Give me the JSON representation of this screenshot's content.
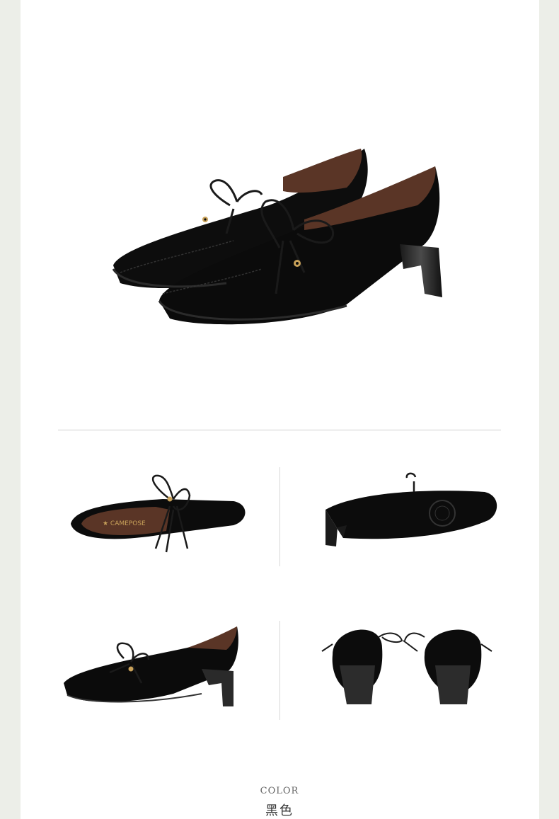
{
  "product": {
    "color_heading": "COLOR",
    "color_name": "黑色"
  },
  "colors": {
    "background": "#eceee8",
    "panel": "#ffffff",
    "suede": "#0b0b0b",
    "lining": "#5a3526",
    "hardware": "#c9a25a"
  },
  "images": [
    {
      "name": "main-pair-view"
    },
    {
      "name": "top-view"
    },
    {
      "name": "sole-view"
    },
    {
      "name": "side-view"
    },
    {
      "name": "back-view"
    }
  ]
}
